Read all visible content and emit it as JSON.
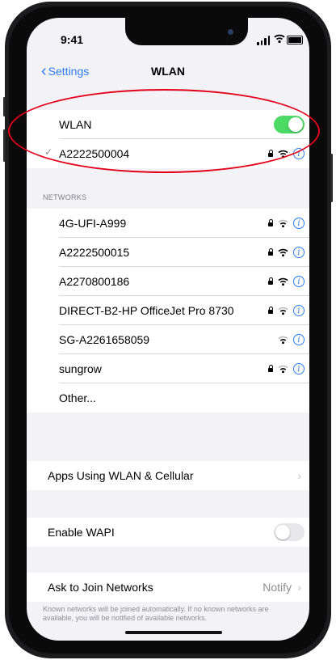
{
  "status_bar": {
    "time": "9:41"
  },
  "nav": {
    "back_label": "Settings",
    "title": "WLAN"
  },
  "wlan_group": {
    "wlan_label": "WLAN",
    "wlan_enabled": true,
    "connected_network": "A2222500004"
  },
  "networks": {
    "header": "NETWORKS",
    "items": [
      {
        "name": "4G-UFI-A999",
        "secured": true
      },
      {
        "name": "A2222500015",
        "secured": true
      },
      {
        "name": "A2270800186",
        "secured": true
      },
      {
        "name": "DIRECT-B2-HP OfficeJet Pro 8730",
        "secured": true
      },
      {
        "name": "SG-A2261658059",
        "secured": false
      },
      {
        "name": "sungrow",
        "secured": true
      }
    ],
    "other_label": "Other..."
  },
  "apps_using": {
    "label": "Apps Using WLAN & Cellular"
  },
  "wapi": {
    "label": "Enable WAPI",
    "enabled": false
  },
  "ask_to_join": {
    "label": "Ask to Join Networks",
    "value": "Notify",
    "note": "Known networks will be joined automatically. If no known networks are available, you will be notified of available networks."
  },
  "colors": {
    "accent": "#2d7cf6",
    "toggle_on": "#4cd964",
    "highlight": "#e4001b"
  }
}
